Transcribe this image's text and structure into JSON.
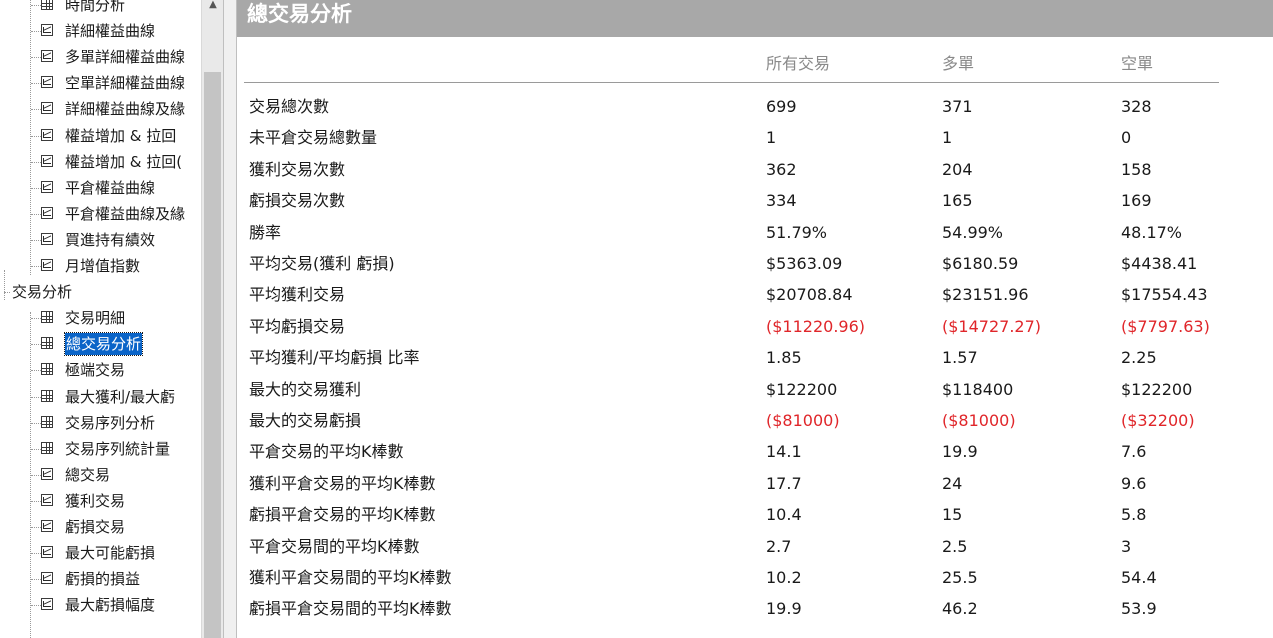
{
  "tree": {
    "items": [
      {
        "label": "時間分析",
        "icon": "grid",
        "level": 2
      },
      {
        "label": "詳細權益曲線",
        "icon": "chart",
        "level": 2
      },
      {
        "label": "多單詳細權益曲線",
        "icon": "chart",
        "level": 2
      },
      {
        "label": "空單詳細權益曲線",
        "icon": "chart",
        "level": 2
      },
      {
        "label": "詳細權益曲線及緣",
        "icon": "chart",
        "level": 2
      },
      {
        "label": "權益增加 & 拉回",
        "icon": "chart",
        "level": 2
      },
      {
        "label": "權益增加 & 拉回(",
        "icon": "chart",
        "level": 2
      },
      {
        "label": "平倉權益曲線",
        "icon": "chart",
        "level": 2
      },
      {
        "label": "平倉權益曲線及緣",
        "icon": "chart",
        "level": 2
      },
      {
        "label": "買進持有績效",
        "icon": "chart",
        "level": 2
      },
      {
        "label": "月增值指數",
        "icon": "chart",
        "level": 2
      },
      {
        "label": "交易分析",
        "icon": "none",
        "level": 1
      },
      {
        "label": "交易明細",
        "icon": "grid",
        "level": 2
      },
      {
        "label": "總交易分析",
        "icon": "grid",
        "level": 2,
        "selected": true
      },
      {
        "label": "極端交易",
        "icon": "grid",
        "level": 2
      },
      {
        "label": "最大獲利/最大虧",
        "icon": "grid",
        "level": 2
      },
      {
        "label": "交易序列分析",
        "icon": "grid",
        "level": 2
      },
      {
        "label": "交易序列統計量",
        "icon": "grid",
        "level": 2
      },
      {
        "label": "總交易",
        "icon": "chart",
        "level": 2
      },
      {
        "label": "獲利交易",
        "icon": "chart",
        "level": 2
      },
      {
        "label": "虧損交易",
        "icon": "chart",
        "level": 2
      },
      {
        "label": "最大可能虧損",
        "icon": "chart",
        "level": 2
      },
      {
        "label": "虧損的損益",
        "icon": "chart",
        "level": 2
      },
      {
        "label": "最大虧損幅度",
        "icon": "chart",
        "level": 2
      }
    ]
  },
  "report": {
    "title": "總交易分析",
    "columns": [
      "所有交易",
      "多單",
      "空單"
    ],
    "rows": [
      {
        "label": "交易總次數",
        "values": [
          "699",
          "371",
          "328"
        ],
        "negative": false
      },
      {
        "label": "未平倉交易總數量",
        "values": [
          "1",
          "1",
          "0"
        ],
        "negative": false
      },
      {
        "label": "獲利交易次數",
        "values": [
          "362",
          "204",
          "158"
        ],
        "negative": false
      },
      {
        "label": "虧損交易次數",
        "values": [
          "334",
          "165",
          "169"
        ],
        "negative": false
      },
      {
        "label": "勝率",
        "values": [
          "51.79%",
          "54.99%",
          "48.17%"
        ],
        "negative": false
      },
      {
        "label": "平均交易(獲利  虧損)",
        "values": [
          "$5363.09",
          "$6180.59",
          "$4438.41"
        ],
        "negative": false
      },
      {
        "label": "平均獲利交易",
        "values": [
          "$20708.84",
          "$23151.96",
          "$17554.43"
        ],
        "negative": false
      },
      {
        "label": "平均虧損交易",
        "values": [
          "($11220.96)",
          "($14727.27)",
          "($7797.63)"
        ],
        "negative": true
      },
      {
        "label": "平均獲利/平均虧損 比率",
        "values": [
          "1.85",
          "1.57",
          "2.25"
        ],
        "negative": false
      },
      {
        "label": "最大的交易獲利",
        "values": [
          "$122200",
          "$118400",
          "$122200"
        ],
        "negative": false
      },
      {
        "label": "最大的交易虧損",
        "values": [
          "($81000)",
          "($81000)",
          "($32200)"
        ],
        "negative": true
      },
      {
        "label": "平倉交易的平均K棒數",
        "values": [
          "14.1",
          "19.9",
          "7.6"
        ],
        "negative": false
      },
      {
        "label": "獲利平倉交易的平均K棒數",
        "values": [
          "17.7",
          "24",
          "9.6"
        ],
        "negative": false
      },
      {
        "label": "虧損平倉交易的平均K棒數",
        "values": [
          "10.4",
          "15",
          "5.8"
        ],
        "negative": false
      },
      {
        "label": "平倉交易間的平均K棒數",
        "values": [
          "2.7",
          "2.5",
          "3"
        ],
        "negative": false
      },
      {
        "label": "獲利平倉交易間的平均K棒數",
        "values": [
          "10.2",
          "25.5",
          "54.4"
        ],
        "negative": false
      },
      {
        "label": "虧損平倉交易間的平均K棒數",
        "values": [
          "19.9",
          "46.2",
          "53.9"
        ],
        "negative": false
      }
    ]
  },
  "colors": {
    "negative": "#e0262a",
    "header_bg": "#a8a8a8",
    "selection": "#0a64c8"
  }
}
